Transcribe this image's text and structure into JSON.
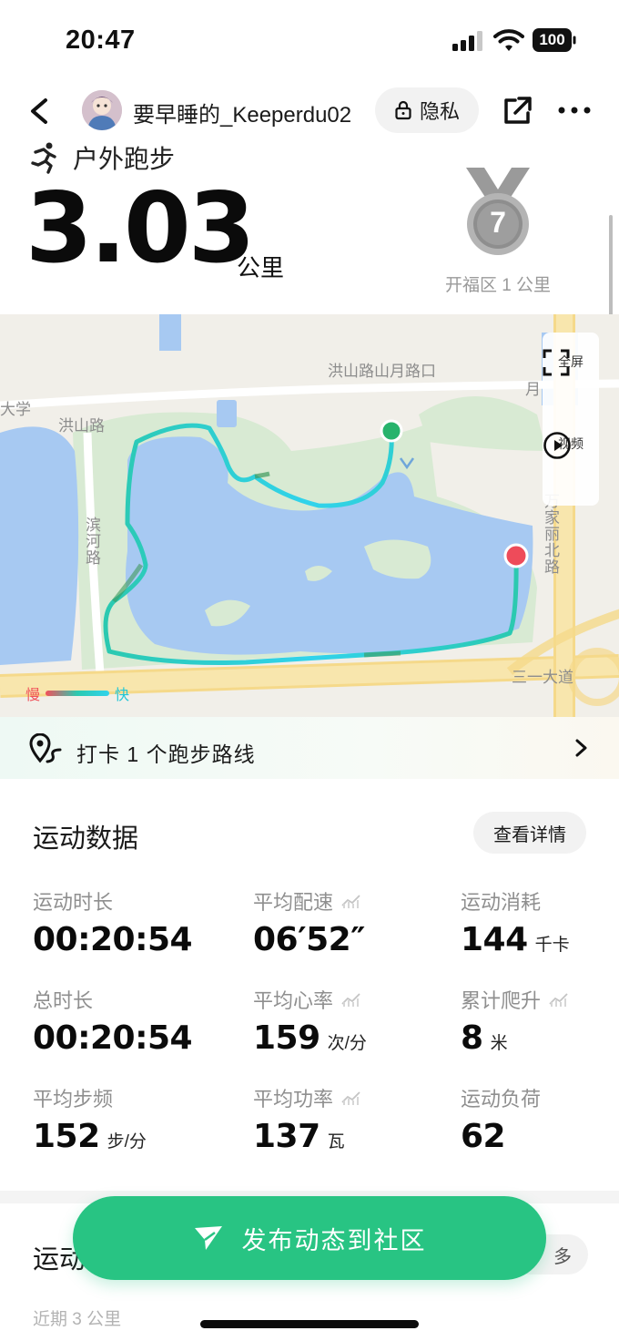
{
  "status_bar": {
    "time": "20:47",
    "battery": "100",
    "icons": [
      "signal-icon",
      "wifi-icon",
      "battery-icon"
    ]
  },
  "nav": {
    "username": "要早睡的_Keeperdu02",
    "privacy_label": "隐私",
    "icons": [
      "back-icon",
      "lock-icon",
      "share-icon",
      "more-icon"
    ]
  },
  "header": {
    "sport_type": "户外跑步",
    "distance": "3.03",
    "distance_unit": "公里",
    "medal_number": "7",
    "medal_caption": "开福区 1 公里"
  },
  "map": {
    "labels": {
      "crossing": "洪山路山月路口",
      "hongshan_road": "洪山路",
      "university": "大学",
      "binhe_road": "滨河路",
      "wanjiali_north": "万家丽北路",
      "sanyi_avenue": "三一大道",
      "yue_partial": "月"
    },
    "controls": {
      "fullscreen_label": "全屏",
      "video_label": "视频"
    },
    "legend": {
      "slow": "慢",
      "fast": "快"
    },
    "colors": {
      "water": "#a7c9f2",
      "park": "#dcebd6",
      "road_major": "#f7e3a6",
      "route_fast": "#31d3ec",
      "route_mid": "#2bc9b0",
      "route_slow": "#3f9a5c",
      "start_marker": "#27b36c",
      "end_marker": "#ee4b5a"
    }
  },
  "checkin": {
    "text": "打卡 1 个跑步路线"
  },
  "sport_data": {
    "title": "运动数据",
    "detail_button": "查看详情",
    "metrics": [
      {
        "label": "运动时长",
        "value": "00:20:54",
        "unit": "",
        "has_chart": false
      },
      {
        "label": "平均配速",
        "value": "06′52″",
        "unit": "",
        "has_chart": true
      },
      {
        "label": "运动消耗",
        "value": "144",
        "unit": "千卡",
        "has_chart": false
      },
      {
        "label": "总时长",
        "value": "00:20:54",
        "unit": "",
        "has_chart": false
      },
      {
        "label": "平均心率",
        "value": "159",
        "unit": "次/分",
        "has_chart": true
      },
      {
        "label": "累计爬升",
        "value": "8",
        "unit": "米",
        "has_chart": true
      },
      {
        "label": "平均步频",
        "value": "152",
        "unit": "步/分",
        "has_chart": false
      },
      {
        "label": "平均功率",
        "value": "137",
        "unit": "瓦",
        "has_chart": true
      },
      {
        "label": "运动负荷",
        "value": "62",
        "unit": "",
        "has_chart": false
      }
    ]
  },
  "lower_card": {
    "title_partial": "运动",
    "more_partial": "多",
    "subtitle_partial": "近期 3 公里"
  },
  "publish_button": {
    "label": "发布动态到社区"
  },
  "accent_color": "#28c483"
}
